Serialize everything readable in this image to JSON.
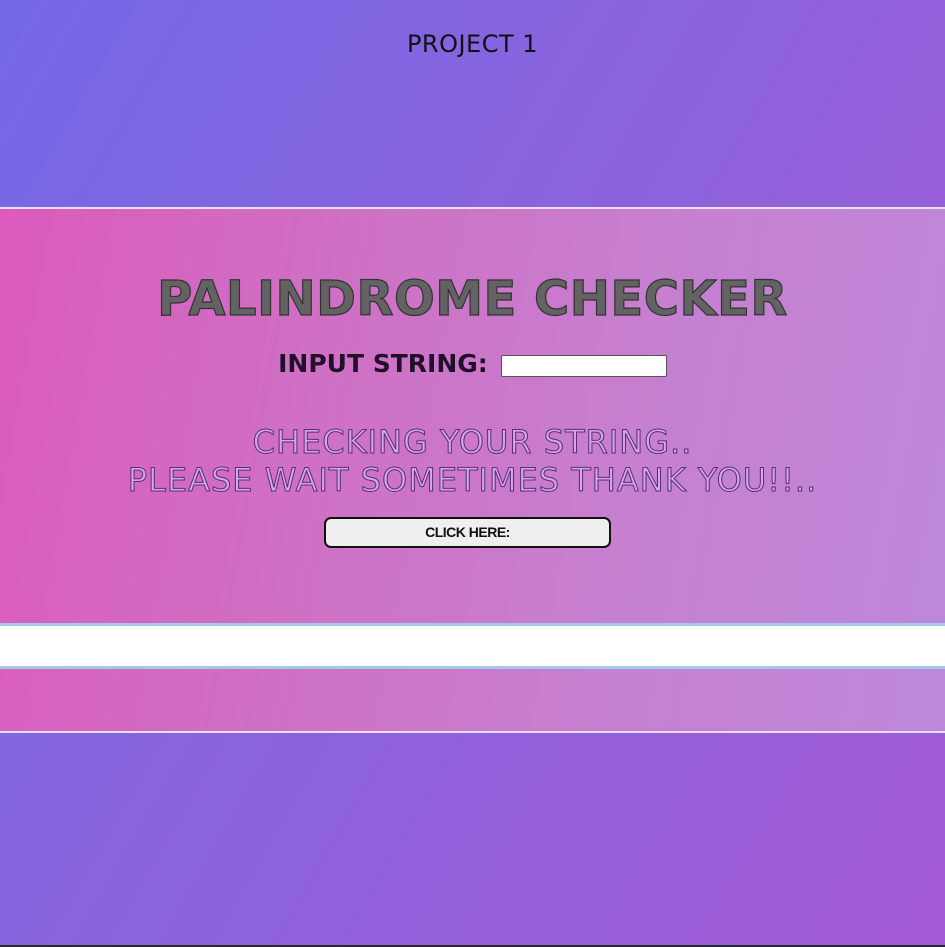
{
  "header": {
    "project_title": "PROJECT 1"
  },
  "checker": {
    "heading": "PALINDROME CHECKER",
    "input_label": "INPUT STRING:",
    "input_value": "",
    "status_line_1": "CHECKING YOUR STRING..",
    "status_line_2": "PLEASE WAIT SOMETIMES THANK YOU!!..",
    "button_label": "CLICK HERE:",
    "result_text": ""
  },
  "colors": {
    "page_gradient_start": "#7468e6",
    "page_gradient_end": "#a35ad4",
    "panel_gradient_start": "#dc5abd",
    "panel_gradient_end": "#bd88da",
    "result_border": "#a2c8ea",
    "heading_text": "#636364"
  }
}
